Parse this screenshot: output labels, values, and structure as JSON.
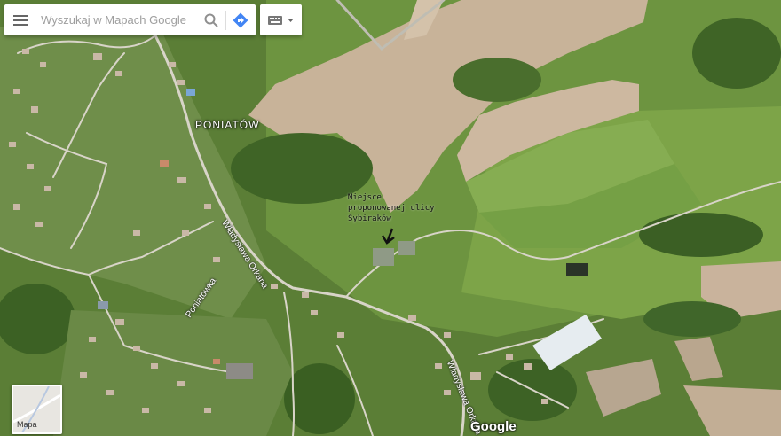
{
  "search": {
    "placeholder": "Wyszukaj w Mapach Google",
    "menu_icon": "hamburger-menu-icon",
    "search_icon": "magnifier-icon",
    "directions_icon": "directions-arrow-icon",
    "keyboard_icon": "keyboard-icon",
    "keyboard_dropdown_icon": "caret-down-icon"
  },
  "map": {
    "type": "satellite",
    "labels": {
      "village": "PONIATÓW",
      "road_1": "Władysława Orkana",
      "road_2": "Władysława Orkana",
      "stream": "Poniatówka"
    },
    "annotation": {
      "line1": "Miejsce",
      "line2": "proponowanej ulicy",
      "line3": "Sybiraków"
    }
  },
  "minimap": {
    "label": "Mapa"
  },
  "attribution": {
    "logo": "Google"
  },
  "colors": {
    "directions_blue": "#4285f4",
    "field_tan": "#c9b59a",
    "grass_green": "#5f8a3c"
  }
}
